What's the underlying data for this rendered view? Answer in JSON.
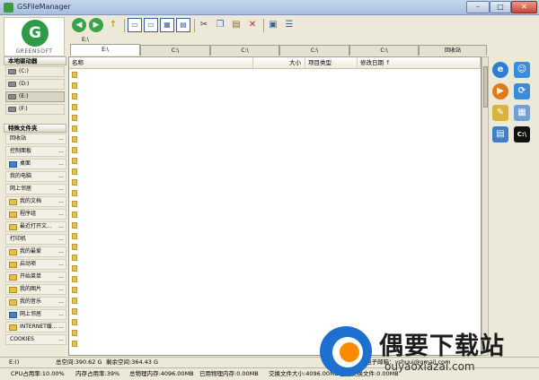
{
  "window": {
    "title": "GSFileManager",
    "controls": {
      "minimize": "–",
      "maximize": "□",
      "close": "✕"
    }
  },
  "logo": {
    "mark": "G",
    "brand": "GREENSOFT",
    "color": "#2e9a46"
  },
  "toolbar": {
    "buttons": [
      {
        "name": "back",
        "glyph": "◀"
      },
      {
        "name": "forward",
        "glyph": "▶"
      },
      {
        "name": "up",
        "glyph": "↑"
      },
      {
        "name": "pane-1",
        "glyph": "▭"
      },
      {
        "name": "pane-2",
        "glyph": "▭"
      },
      {
        "name": "pane-3",
        "glyph": "▦"
      },
      {
        "name": "pane-4",
        "glyph": "▤"
      },
      {
        "name": "cut",
        "glyph": "✂"
      },
      {
        "name": "copy",
        "glyph": "❐"
      },
      {
        "name": "paste",
        "glyph": "▤"
      },
      {
        "name": "delete",
        "glyph": "✕"
      },
      {
        "name": "properties",
        "glyph": "▣"
      },
      {
        "name": "view",
        "glyph": "☰"
      }
    ]
  },
  "path": "E:\\",
  "tabs": [
    "E:\\",
    "C:\\",
    "C:\\",
    "C:\\",
    "C:\\",
    "回收站"
  ],
  "sidebar": {
    "drives_header": "本地驱动器",
    "drives": [
      "(C:)",
      "(D:)",
      "(E:)",
      "(F:)"
    ],
    "folders_header": "特殊文件夹",
    "folders": [
      "回收站",
      "控制面板",
      "桌面",
      "我的电脑",
      "网上邻居",
      "我的文档",
      "程序组",
      "最近打开文...",
      "打印机",
      "我的最爱",
      "启动项",
      "开始菜单",
      "我的图片",
      "我的音乐",
      "网上邻居",
      "INTERNET缓...",
      "COOKIES"
    ],
    "more": "..."
  },
  "list": {
    "columns": {
      "name": "名称",
      "size": "大小",
      "type": "项目类型",
      "date": "修改日期 ↑"
    }
  },
  "status": {
    "drive": "E:()",
    "total_space": "总空间:390.62 G",
    "free_space": "剩余空间:364.43 G",
    "author": "作者：青草 ..... 电子邮箱：yshuui@gmail.com",
    "cpu": "CPU占用率:10.00%",
    "memory": "内存占用率:39%",
    "total_phys": "总物理内存:4096.00MB",
    "used_phys": "已用物理内存:0.00MB",
    "swap": "交换文件大小:4096.00MB",
    "swap_used": "已用交换文件:0.00MB"
  },
  "watermark": {
    "title": "偶要下载站",
    "url": "ouyaoxiazai.com"
  },
  "colors": {
    "accent": "#2e9a46",
    "folder": "#e8bf53",
    "watermark_blue": "#1d6fd0"
  }
}
